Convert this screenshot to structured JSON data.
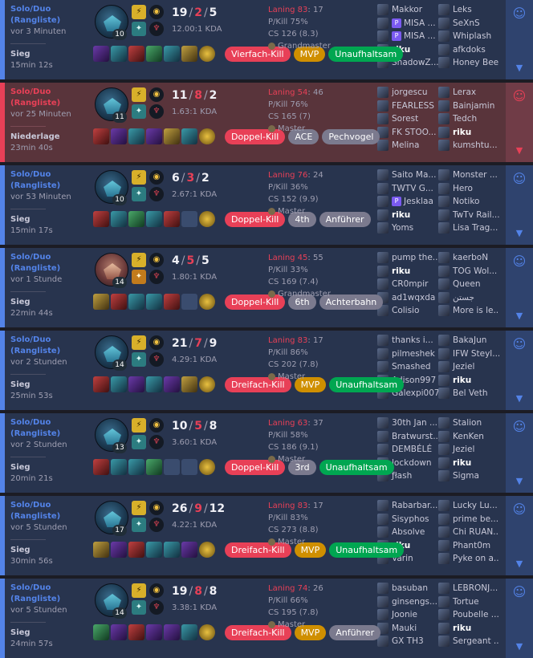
{
  "matches": [
    {
      "outcome": "win",
      "queue": "Solo/Duo",
      "queue_sub": "(Rangliste)",
      "ago": "vor 3 Minuten",
      "result": "Sieg",
      "duration": "15min 12s",
      "level": "10",
      "kills": "19",
      "deaths": "2",
      "assists": "5",
      "kda_ratio": "12.00:1 KDA",
      "laning_label": "Laning 83",
      "laning_num": ": 17",
      "pkill": "P/Kill 75%",
      "cs": "CS 126 (8.3)",
      "rank": "Grandmaster",
      "badges": [
        {
          "text": "Vierfach-Kill",
          "color": "red"
        },
        {
          "text": "MVP",
          "color": "gold"
        },
        {
          "text": "Unaufhaltsam",
          "color": "green"
        }
      ],
      "team1": [
        {
          "name": "Makkor"
        },
        {
          "name": "MISA ...",
          "premium": true
        },
        {
          "name": "MISA ...",
          "premium": true
        },
        {
          "name": "riku",
          "me": true
        },
        {
          "name": "ShadowZ..."
        }
      ],
      "team2": [
        {
          "name": "Leks"
        },
        {
          "name": "SeXnS"
        },
        {
          "name": "Whiplash"
        },
        {
          "name": "afkdoks"
        },
        {
          "name": "Honey Bee"
        }
      ]
    },
    {
      "outcome": "loss",
      "queue": "Solo/Duo",
      "queue_sub": "(Rangliste)",
      "ago": "vor 25 Minuten",
      "result": "Niederlage",
      "duration": "23min 40s",
      "level": "11",
      "kills": "11",
      "deaths": "8",
      "assists": "2",
      "kda_ratio": "1.63:1 KDA",
      "laning_label": "Laning 54",
      "laning_num": ": 46",
      "pkill": "P/Kill 76%",
      "cs": "CS 165 (7)",
      "rank": "Master",
      "badges": [
        {
          "text": "Doppel-Kill",
          "color": "red"
        },
        {
          "text": "ACE",
          "color": "gray"
        },
        {
          "text": "Pechvogel",
          "color": "gray"
        }
      ],
      "team1": [
        {
          "name": "jorgescu"
        },
        {
          "name": "FEARLESS"
        },
        {
          "name": "Sorest"
        },
        {
          "name": "FK STOO..."
        },
        {
          "name": "Melina"
        }
      ],
      "team2": [
        {
          "name": "Lerax"
        },
        {
          "name": "Bainjamin"
        },
        {
          "name": "Tedch"
        },
        {
          "name": "riku",
          "me": true
        },
        {
          "name": "kumshtu..."
        }
      ]
    },
    {
      "outcome": "win",
      "queue": "Solo/Duo",
      "queue_sub": "(Rangliste)",
      "ago": "vor 53 Minuten",
      "result": "Sieg",
      "duration": "15min 17s",
      "level": "10",
      "kills": "6",
      "deaths": "3",
      "assists": "2",
      "kda_ratio": "2.67:1 KDA",
      "laning_label": "Laning 76",
      "laning_num": ": 24",
      "pkill": "P/Kill 36%",
      "cs": "CS 152 (9.9)",
      "rank": "Master",
      "badges": [
        {
          "text": "Doppel-Kill",
          "color": "red"
        },
        {
          "text": "4th",
          "color": "gray"
        },
        {
          "text": "Anführer",
          "color": "gray"
        }
      ],
      "team1": [
        {
          "name": "Saito Ma..."
        },
        {
          "name": "TWTV G..."
        },
        {
          "name": "Jesklaa",
          "premium": true
        },
        {
          "name": "riku",
          "me": true
        },
        {
          "name": "Yoms"
        }
      ],
      "team2": [
        {
          "name": "Monster ..."
        },
        {
          "name": "Hero"
        },
        {
          "name": "Notiko"
        },
        {
          "name": "TwTv Rail..."
        },
        {
          "name": "Lisa Trag..."
        }
      ]
    },
    {
      "outcome": "win",
      "queue": "Solo/Duo",
      "queue_sub": "(Rangliste)",
      "ago": "vor 1 Stunde",
      "result": "Sieg",
      "duration": "22min 44s",
      "level": "14",
      "kills": "4",
      "deaths": "5",
      "assists": "5",
      "kda_ratio": "1.80:1 KDA",
      "laning_label": "Laning 45",
      "laning_num": ": 55",
      "pkill": "P/Kill 33%",
      "cs": "CS 169 (7.4)",
      "rank": "Grandmaster",
      "badges": [
        {
          "text": "Doppel-Kill",
          "color": "red"
        },
        {
          "text": "6th",
          "color": "gray"
        },
        {
          "text": "Achterbahn",
          "color": "gray"
        }
      ],
      "team1": [
        {
          "name": "pump the..."
        },
        {
          "name": "riku",
          "me": true
        },
        {
          "name": "CR0mpir"
        },
        {
          "name": "ad1wqxda"
        },
        {
          "name": "Colisio"
        }
      ],
      "team2": [
        {
          "name": "kaerboN"
        },
        {
          "name": "TOG Wol..."
        },
        {
          "name": "Queen"
        },
        {
          "name": "جستن"
        },
        {
          "name": "More is le..."
        }
      ]
    },
    {
      "outcome": "win",
      "queue": "Solo/Duo",
      "queue_sub": "(Rangliste)",
      "ago": "vor 2 Stunden",
      "result": "Sieg",
      "duration": "25min 53s",
      "level": "14",
      "kills": "21",
      "deaths": "7",
      "assists": "9",
      "kda_ratio": "4.29:1 KDA",
      "laning_label": "Laning 83",
      "laning_num": ": 17",
      "pkill": "P/Kill 86%",
      "cs": "CS 202 (7.8)",
      "rank": "Master",
      "badges": [
        {
          "text": "Dreifach-Kill",
          "color": "red"
        },
        {
          "text": "MVP",
          "color": "gold"
        },
        {
          "text": "Unaufhaltsam",
          "color": "green"
        }
      ],
      "team1": [
        {
          "name": "thanks i..."
        },
        {
          "name": "pilmeshek"
        },
        {
          "name": "Smashed"
        },
        {
          "name": "Adison997"
        },
        {
          "name": "Galexpi007"
        }
      ],
      "team2": [
        {
          "name": "BakaJun"
        },
        {
          "name": "IFW Steyl..."
        },
        {
          "name": "Jeziel"
        },
        {
          "name": "riku",
          "me": true
        },
        {
          "name": "Bel Veth"
        }
      ]
    },
    {
      "outcome": "win",
      "queue": "Solo/Duo",
      "queue_sub": "(Rangliste)",
      "ago": "vor 2 Stunden",
      "result": "Sieg",
      "duration": "20min 21s",
      "level": "13",
      "kills": "10",
      "deaths": "5",
      "assists": "8",
      "kda_ratio": "3.60:1 KDA",
      "laning_label": "Laning 63",
      "laning_num": ": 37",
      "pkill": "P/Kill 58%",
      "cs": "CS 186 (9.1)",
      "rank": "Master",
      "badges": [
        {
          "text": "Doppel-Kill",
          "color": "red"
        },
        {
          "text": "3rd",
          "color": "gray"
        },
        {
          "text": "Unaufhaltsam",
          "color": "green"
        }
      ],
      "team1": [
        {
          "name": "30th Jan ..."
        },
        {
          "name": "Bratwurst..."
        },
        {
          "name": "DEMBÉLÉ"
        },
        {
          "name": "lockdown"
        },
        {
          "name": "ƒłash"
        }
      ],
      "team2": [
        {
          "name": "Stalion"
        },
        {
          "name": "KenKen"
        },
        {
          "name": "Jeziel"
        },
        {
          "name": "riku",
          "me": true
        },
        {
          "name": "Sigma"
        }
      ]
    },
    {
      "outcome": "win",
      "queue": "Solo/Duo",
      "queue_sub": "(Rangliste)",
      "ago": "vor 5 Stunden",
      "result": "Sieg",
      "duration": "30min 56s",
      "level": "17",
      "kills": "26",
      "deaths": "9",
      "assists": "12",
      "kda_ratio": "4.22:1 KDA",
      "laning_label": "Laning 83",
      "laning_num": ": 17",
      "pkill": "P/Kill 83%",
      "cs": "CS 273 (8.8)",
      "rank": "Master",
      "badges": [
        {
          "text": "Dreifach-Kill",
          "color": "red"
        },
        {
          "text": "MVP",
          "color": "gold"
        },
        {
          "text": "Unaufhaltsam",
          "color": "green"
        }
      ],
      "team1": [
        {
          "name": "Rabarbar..."
        },
        {
          "name": "Sisyphos"
        },
        {
          "name": "Absolve"
        },
        {
          "name": "riku",
          "me": true
        },
        {
          "name": "Varin"
        }
      ],
      "team2": [
        {
          "name": "Lucky Lu..."
        },
        {
          "name": "prime be..."
        },
        {
          "name": "Chi RUAN..."
        },
        {
          "name": "Phant0m"
        },
        {
          "name": "Pyke on a..."
        }
      ]
    },
    {
      "outcome": "win",
      "queue": "Solo/Duo",
      "queue_sub": "(Rangliste)",
      "ago": "vor 5 Stunden",
      "result": "Sieg",
      "duration": "24min 57s",
      "level": "14",
      "kills": "19",
      "deaths": "8",
      "assists": "8",
      "kda_ratio": "3.38:1 KDA",
      "laning_label": "Laning 74",
      "laning_num": ": 26",
      "pkill": "P/Kill 66%",
      "cs": "CS 195 (7.8)",
      "rank": "Master",
      "badges": [
        {
          "text": "Dreifach-Kill",
          "color": "red"
        },
        {
          "text": "MVP",
          "color": "gold"
        },
        {
          "text": "Anführer",
          "color": "gray"
        }
      ],
      "team1": [
        {
          "name": "basuban"
        },
        {
          "name": "ginsengs..."
        },
        {
          "name": "Joonie"
        },
        {
          "name": "Mauki"
        },
        {
          "name": "GX TH3"
        }
      ],
      "team2": [
        {
          "name": "LEBRONJ..."
        },
        {
          "name": "Tortue"
        },
        {
          "name": "Poubelle ..."
        },
        {
          "name": "riku",
          "me": true
        },
        {
          "name": "Sergeant ..."
        }
      ]
    }
  ],
  "colors": {
    "win_accent": "#5383e8",
    "loss_accent": "#e84057",
    "win_bg": "#28344e",
    "loss_bg": "#59343b"
  },
  "icons": {
    "action": "add-favorite-icon",
    "expand": "chevron-down-icon"
  }
}
